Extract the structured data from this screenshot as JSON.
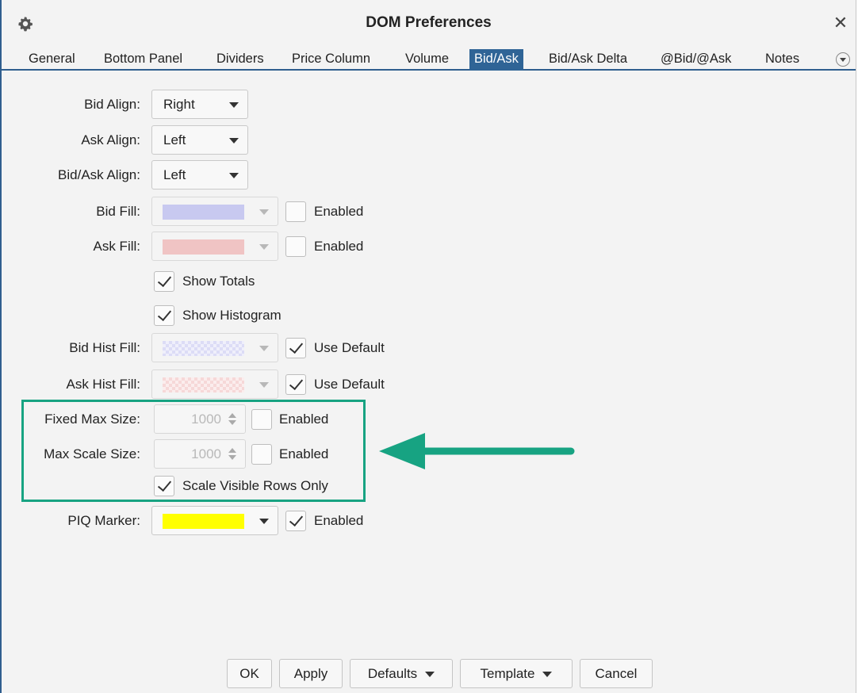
{
  "window": {
    "title": "DOM Preferences",
    "icon": "gear-icon",
    "close_glyph": "✕"
  },
  "tabs": [
    "General",
    "Bottom Panel",
    "Dividers",
    "Price Column",
    "Volume",
    "Bid/Ask",
    "Bid/Ask Delta",
    "@Bid/@Ask",
    "Notes"
  ],
  "active_tab": "Bid/Ask",
  "form": {
    "bid_align": {
      "label": "Bid Align:",
      "value": "Right"
    },
    "ask_align": {
      "label": "Ask Align:",
      "value": "Left"
    },
    "bidask_align": {
      "label": "Bid/Ask Align:",
      "value": "Left"
    },
    "bid_fill": {
      "label": "Bid Fill:",
      "color": "#c8c9f0",
      "enabled_label": "Enabled",
      "enabled": false
    },
    "ask_fill": {
      "label": "Ask Fill:",
      "color": "#f0c4c4",
      "enabled_label": "Enabled",
      "enabled": false
    },
    "show_totals": {
      "label": "Show Totals",
      "checked": true
    },
    "show_histogram": {
      "label": "Show Histogram",
      "checked": true
    },
    "bid_hist_fill": {
      "label": "Bid Hist Fill:",
      "color": "#dcdcf6",
      "default_label": "Use Default",
      "use_default": true
    },
    "ask_hist_fill": {
      "label": "Ask Hist Fill:",
      "color": "#f6d8d8",
      "default_label": "Use Default",
      "use_default": true
    },
    "fixed_max_size": {
      "label": "Fixed Max Size:",
      "value": "1000",
      "enabled_label": "Enabled",
      "enabled": false
    },
    "max_scale_size": {
      "label": "Max Scale Size:",
      "value": "1000",
      "enabled_label": "Enabled",
      "enabled": false
    },
    "scale_visible_rows": {
      "label": "Scale Visible Rows Only",
      "checked": true
    },
    "piq_marker": {
      "label": "PIQ Marker:",
      "color": "#ffff00",
      "enabled_label": "Enabled",
      "enabled": true
    }
  },
  "annotation": {
    "highlight_color": "#17a382",
    "arrow_color": "#17a382"
  },
  "buttons": {
    "ok": "OK",
    "apply": "Apply",
    "defaults": "Defaults",
    "template": "Template",
    "cancel": "Cancel"
  }
}
